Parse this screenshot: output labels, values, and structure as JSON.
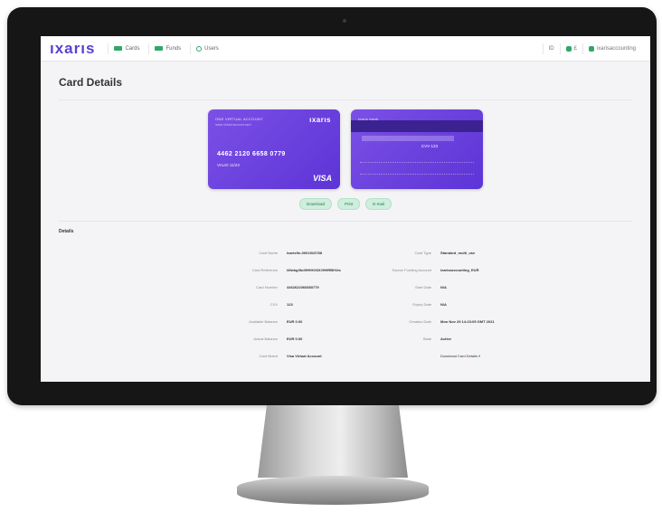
{
  "header": {
    "logo": "ıxarıs",
    "nav": [
      {
        "label": "Cards"
      },
      {
        "label": "Funds"
      },
      {
        "label": "Users"
      }
    ],
    "right": {
      "item_1": "ID",
      "item_2": "£",
      "account": "ixarisaccounting"
    }
  },
  "page": {
    "title": "Card Details"
  },
  "card_front": {
    "program": "ONE VIRTUAL ACCOUNT",
    "subprogram": "ixaris virtual account card",
    "logo": "ıxarıs",
    "number": "4462 2120 6658 0779",
    "expiry": "VALID 11/23",
    "brand": "VISA"
  },
  "card_back": {
    "header": "ixaris bank",
    "cvv": "CVV 123"
  },
  "actions": [
    {
      "label": "Download"
    },
    {
      "label": "Print"
    },
    {
      "label": "E-mail"
    }
  ],
  "details": {
    "heading": "Details",
    "rows": [
      {
        "l1": "Card Name",
        "v1": "Ixarisfin-0001523788",
        "l2": "Card Type",
        "v2": "Standard_multi_use"
      },
      {
        "l1": "Card Reference",
        "v1": "I4fwkg3fu0HHHOf2fJHHRBH1ts",
        "l2": "Source Funding Account",
        "v2": "ixarisaccounting_EUR"
      },
      {
        "l1": "Card Number",
        "v1": "4462622066580779",
        "l2": "Start Date",
        "v2": "N/A"
      },
      {
        "l1": "CVV",
        "v1": "123",
        "l2": "Expiry Date",
        "v2": "N/A"
      },
      {
        "l1": "Available Balance",
        "v1": "EUR 0.00",
        "l2": "Creation Date",
        "v2": "Mon Nov 29 14:23:05 GMT 2021"
      },
      {
        "l1": "Actual Balance",
        "v1": "EUR 0.00",
        "l2": "State",
        "v2": "Active"
      },
      {
        "l1": "Card Brand",
        "v1": "Visa Virtual Account",
        "l2": "",
        "v2": "Download Card Details"
      }
    ]
  },
  "colors": {
    "brand": "#5b3fd4",
    "card": "#6a40de",
    "accent": "#2fa866"
  }
}
